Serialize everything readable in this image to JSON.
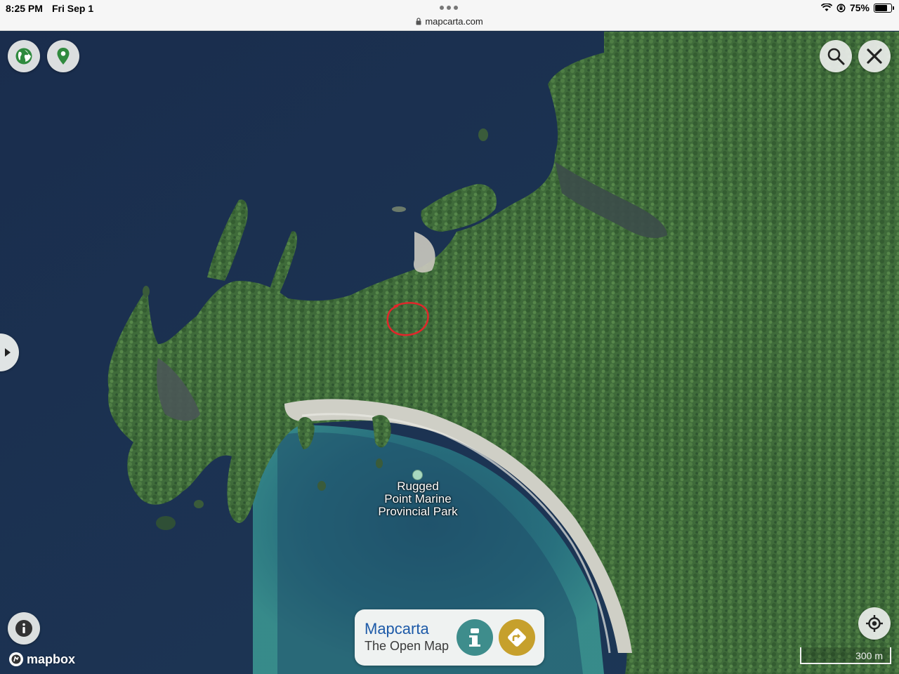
{
  "status_bar": {
    "time": "8:25 PM",
    "date": "Fri Sep 1",
    "url": "mapcarta.com",
    "battery": "75%",
    "battery_level": 0.75
  },
  "map": {
    "place_label": "Rugged\nPoint Marine\nProvincial Park",
    "scale_label": "300 m",
    "attribution": "mapbox",
    "annotation": "red-hand-drawn-circle"
  },
  "brand_card": {
    "name": "Mapcarta",
    "tagline": "The Open Map"
  },
  "icons": {
    "globe": "globe-icon",
    "pin": "map-pin-icon",
    "search": "search-icon",
    "close": "close-icon",
    "info": "info-icon",
    "locate": "locate-icon",
    "panel_toggle": "play-triangle-icon",
    "place_info": "info-i-icon",
    "directions": "directions-icon"
  },
  "colors": {
    "water_deep": "#1b2f4d",
    "water_shallow": "#2c7d86",
    "forest": "#3f6b3a",
    "beach": "#cfcfc6",
    "brand_blue": "#1d5aa8",
    "info_teal": "#3e8d8c",
    "directions_gold": "#c6a02c",
    "annotation_red": "#e0262b"
  }
}
